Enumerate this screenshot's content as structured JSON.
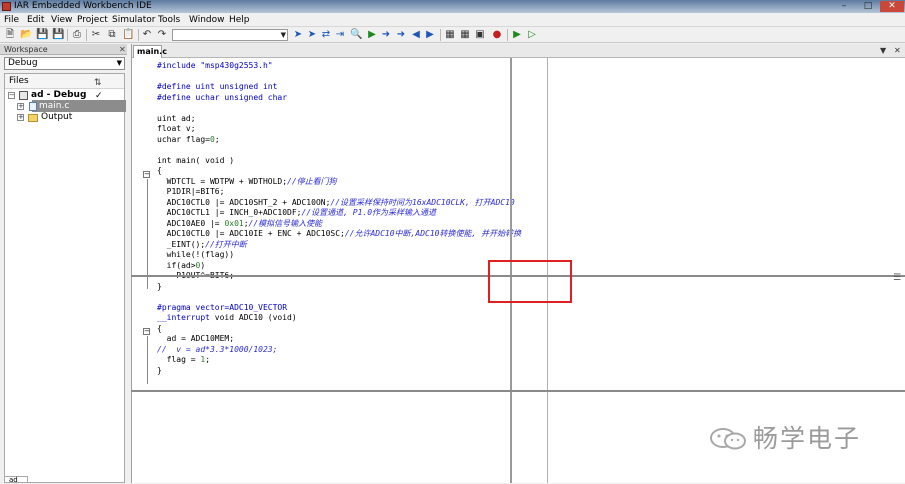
{
  "window": {
    "title": "IAR Embedded Workbench IDE"
  },
  "menu": [
    "File",
    "Edit",
    "View",
    "Project",
    "Simulator",
    "Tools",
    "Window",
    "Help"
  ],
  "toolbar": {
    "icons": [
      "new-file-icon",
      "open-icon",
      "save-icon",
      "save-all-icon",
      "print-icon",
      "cut-icon",
      "copy-icon",
      "paste-icon",
      "undo-icon",
      "redo-icon",
      "find-icon",
      "bookmark-icon",
      "make-icon",
      "debug-icon",
      "breakpoint-icon"
    ],
    "search_value": ""
  },
  "workspace": {
    "caption": "Workspace",
    "config_selected": "Debug",
    "files_header": "Files",
    "project_label": "ad - Debug",
    "tree": [
      {
        "label": "main.c",
        "type": "file",
        "selected": true
      },
      {
        "label": "Output",
        "type": "folder",
        "selected": false
      }
    ],
    "bottom_tab": "ad"
  },
  "editor": {
    "tab_label": "main.c",
    "lines": [
      [
        [
          "pp",
          "#include \"msp430g2553.h\""
        ]
      ],
      [
        [
          "",
          ""
        ]
      ],
      [
        [
          "pp",
          "#define uint unsigned int"
        ]
      ],
      [
        [
          "pp",
          "#define uchar unsigned char"
        ]
      ],
      [
        [
          "",
          ""
        ]
      ],
      [
        [
          "kw",
          "uint ad;"
        ]
      ],
      [
        [
          "kw",
          "float v;"
        ]
      ],
      [
        [
          "kw",
          "uchar flag="
        ],
        [
          "nm",
          "0"
        ],
        [
          "kw",
          ";"
        ]
      ],
      [
        [
          "",
          ""
        ]
      ],
      [
        [
          "kw",
          "int main( void )"
        ]
      ],
      [
        [
          "kw",
          "{"
        ]
      ],
      [
        [
          "kw",
          "  WDTCTL = WDTPW + WDTHOLD;"
        ],
        [
          "cm",
          "//停止看门狗"
        ]
      ],
      [
        [
          "kw",
          "  P1DIR|=BIT6;"
        ]
      ],
      [
        [
          "kw",
          "  ADC10CTL0 |= ADC10SHT_2 + ADC10ON;"
        ],
        [
          "cm",
          "//设置采样保持时间为16xADC10CLK, 打开ADC10"
        ]
      ],
      [
        [
          "kw",
          "  ADC10CTL1 |= INCH_0+ADC10DF;"
        ],
        [
          "cm",
          "//设置通道, P1.0作为采样输入通道"
        ]
      ],
      [
        [
          "kw",
          "  ADC10AE0 |= "
        ],
        [
          "nm",
          "0x01"
        ],
        [
          "kw",
          ";"
        ],
        [
          "cm",
          "//模拟信号输入使能"
        ]
      ],
      [
        [
          "kw",
          "  ADC10CTL0 |= ADC10IE + ENC + ADC10SC;"
        ],
        [
          "cm",
          "//允许ADC10中断,ADC10转换使能, 并开始转换"
        ]
      ],
      [
        [
          "kw",
          "  _EINT();"
        ],
        [
          "cm",
          "//打开中断"
        ]
      ],
      [
        [
          "kw",
          "  while(!(flag))"
        ]
      ],
      [
        [
          "kw",
          "  if(ad>"
        ],
        [
          "nm",
          "0"
        ],
        [
          "kw",
          ")"
        ]
      ],
      [
        [
          "kw",
          "    P1OUT^=BIT6;"
        ]
      ],
      [
        [
          "kw",
          "}"
        ]
      ],
      [
        [
          "",
          ""
        ]
      ],
      [
        [
          "pp",
          "#pragma vector=ADC10_VECTOR"
        ]
      ],
      [
        [
          "pp",
          "__interrupt"
        ],
        [
          "kw",
          " void ADC10 (void)"
        ]
      ],
      [
        [
          "kw",
          "{"
        ]
      ],
      [
        [
          "kw",
          "  ad = ADC10MEM;"
        ]
      ],
      [
        [
          "cm",
          "//  v = ad*3.3*1000/1023;"
        ]
      ],
      [
        [
          "kw",
          "  flag = "
        ],
        [
          "nm",
          "1"
        ],
        [
          "kw",
          ";"
        ]
      ],
      [
        [
          "kw",
          "}"
        ]
      ]
    ]
  },
  "watermark": {
    "text": "畅学电子"
  }
}
